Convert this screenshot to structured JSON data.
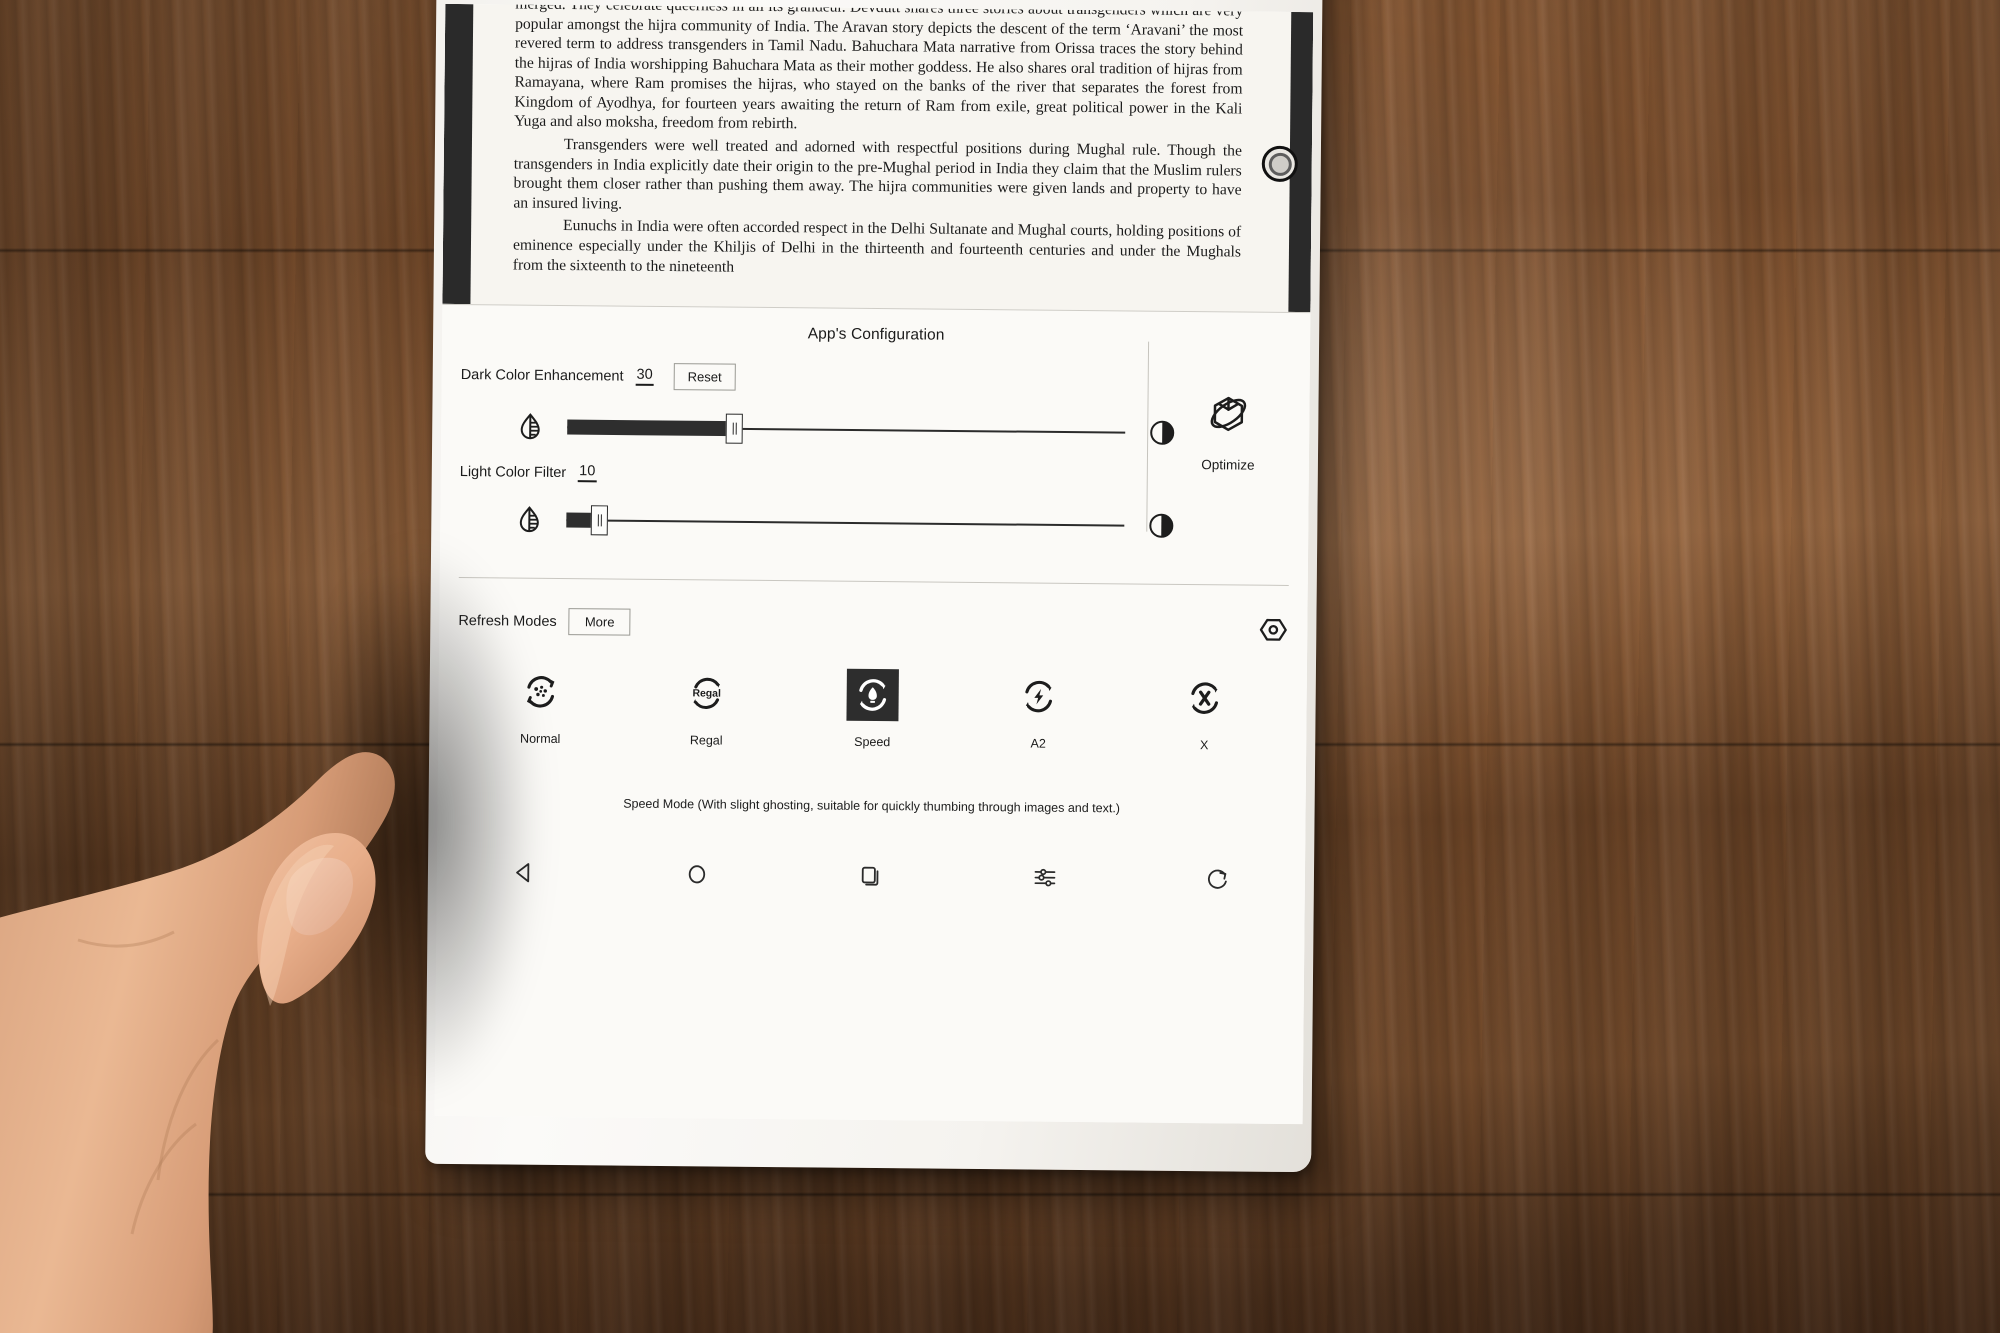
{
  "document": {
    "paragraphs": [
      "merged. They celebrate queerness in all its grandeur. Devdutt shares three stories about transgenders which are very popular amongst the hijra community of India. The Aravan story depicts the descent of the term ‘Aravani’ the most revered term to address transgenders in Tamil Nadu. Bahuchara Mata narrative from Orissa traces the story behind the hijras of India worshipping Bahuchara Mata as their mother goddess. He also shares oral tradition of hijras from Ramayana, where Ram promises the hijras, who stayed on the banks of the river that separates the forest from Kingdom of Ayodhya, for fourteen years awaiting the return of Ram from exile, great political power in the Kali Yuga and also moksha, freedom from rebirth.",
      "Transgenders were well treated and adorned with respectful positions during Mughal rule. Though the transgenders in India explicitly date their origin to the pre-Mughal period in India they claim that the Muslim rulers brought them closer rather than pushing them away. The hijra communities were given lands and property to have an insured living.",
      "Eunuchs in India were often accorded respect in the Delhi Sultanate and Mughal courts, holding positions of eminence especially under the Khiljis of Delhi in the thirteenth and fourteenth centuries and under the Mughals from the sixteenth to the nineteenth"
    ]
  },
  "panel": {
    "title": "App's Configuration",
    "dark_color": {
      "label": "Dark Color Enhancement",
      "value": "30",
      "reset_label": "Reset",
      "percent": 30,
      "left_icon": "half-fill-droplet-icon",
      "right_icon": "half-circle-contrast-icon"
    },
    "light_filter": {
      "label": "Light Color Filter",
      "value": "10",
      "percent": 6,
      "left_icon": "half-fill-droplet-icon",
      "right_icon": "half-circle-contrast-icon"
    },
    "optimize": {
      "label": "Optimize",
      "icon": "cube-orbit-icon"
    },
    "refresh": {
      "label": "Refresh Modes",
      "more_label": "More",
      "settings_icon": "hex-nut-icon",
      "modes": [
        {
          "label": "Normal",
          "icon": "refresh-dots-icon",
          "selected": false
        },
        {
          "label": "Regal",
          "icon": "refresh-regal-icon",
          "selected": false
        },
        {
          "label": "Speed",
          "icon": "refresh-rocket-icon",
          "selected": true
        },
        {
          "label": "A2",
          "icon": "refresh-bolt-icon",
          "selected": false
        },
        {
          "label": "X",
          "icon": "refresh-x-icon",
          "selected": false
        }
      ],
      "description": "Speed Mode (With slight ghosting, suitable for quickly thumbing through images and text.)"
    }
  },
  "navbar": {
    "items": [
      {
        "name": "back",
        "icon": "triangle-back-icon"
      },
      {
        "name": "home",
        "icon": "circle-home-icon"
      },
      {
        "name": "recents",
        "icon": "stacked-pages-icon"
      },
      {
        "name": "settings",
        "icon": "sliders-icon"
      },
      {
        "name": "refresh",
        "icon": "circular-arrow-icon"
      }
    ]
  },
  "colors": {
    "ink": "#1b1b1b",
    "panel_bg": "#fbfaf7",
    "selected_bg": "#2d2d2d",
    "desk_wood": "#8a5a35"
  }
}
